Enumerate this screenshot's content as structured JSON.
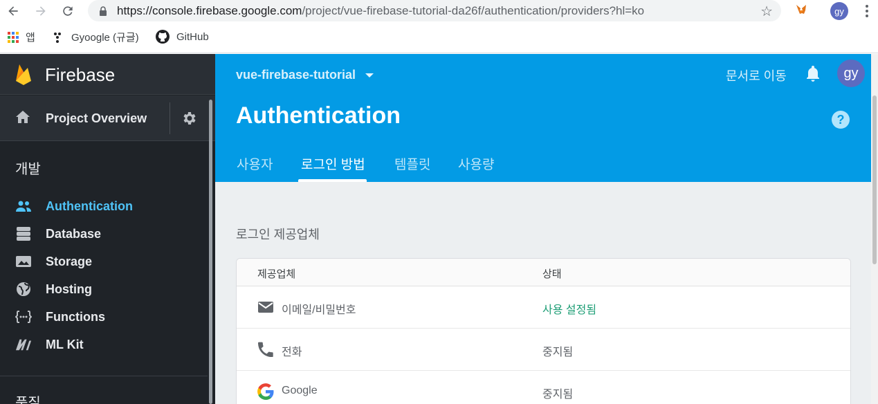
{
  "browser": {
    "url_host": "https://console.firebase.google.com",
    "url_path": "/project/vue-firebase-tutorial-da26f/authentication/providers?hl=ko",
    "profile_initials": "gy"
  },
  "bookmarks": [
    {
      "label": "앱"
    },
    {
      "label": "Gyoogle (규글)"
    },
    {
      "label": "GitHub"
    }
  ],
  "sidebar": {
    "brand": "Firebase",
    "overview_label": "Project Overview",
    "section_develop": "개발",
    "section_quality": "품질",
    "items": [
      {
        "label": "Authentication",
        "icon": "people-icon",
        "active": true
      },
      {
        "label": "Database",
        "icon": "database-icon"
      },
      {
        "label": "Storage",
        "icon": "image-icon"
      },
      {
        "label": "Hosting",
        "icon": "globe-icon"
      },
      {
        "label": "Functions",
        "icon": "functions-icon"
      },
      {
        "label": "ML Kit",
        "icon": "mlkit-icon"
      }
    ]
  },
  "header": {
    "project_name": "vue-firebase-tutorial",
    "docs_link": "문서로 이동",
    "avatar_initials": "gy",
    "title": "Authentication",
    "help": "?",
    "tabs": [
      {
        "label": "사용자"
      },
      {
        "label": "로그인 방법",
        "active": true
      },
      {
        "label": "템플릿"
      },
      {
        "label": "사용량"
      }
    ]
  },
  "main": {
    "section_title": "로그인 제공업체",
    "table": {
      "headers": [
        "제공업체",
        "상태"
      ],
      "rows": [
        {
          "provider": "이메일/비밀번호",
          "status": "사용 설정됨",
          "icon": "email-icon"
        },
        {
          "provider": "전화",
          "status": "중지됨",
          "icon": "phone-icon"
        },
        {
          "provider": "Google",
          "status": "중지됨",
          "icon": "google-icon"
        }
      ]
    }
  },
  "colors": {
    "header_blue": "#039be5",
    "sidebar_dark": "#1f2328",
    "active_link": "#4fc3f7",
    "enabled_green": "#1e9e76"
  }
}
